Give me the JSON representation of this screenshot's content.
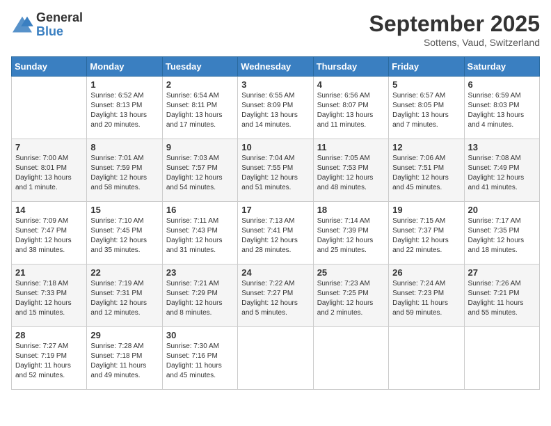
{
  "header": {
    "logo": {
      "general": "General",
      "blue": "Blue"
    },
    "title": "September 2025",
    "location": "Sottens, Vaud, Switzerland"
  },
  "weekdays": [
    "Sunday",
    "Monday",
    "Tuesday",
    "Wednesday",
    "Thursday",
    "Friday",
    "Saturday"
  ],
  "weeks": [
    [
      {
        "day": "",
        "sunrise": "",
        "sunset": "",
        "daylight": ""
      },
      {
        "day": "1",
        "sunrise": "Sunrise: 6:52 AM",
        "sunset": "Sunset: 8:13 PM",
        "daylight": "Daylight: 13 hours and 20 minutes."
      },
      {
        "day": "2",
        "sunrise": "Sunrise: 6:54 AM",
        "sunset": "Sunset: 8:11 PM",
        "daylight": "Daylight: 13 hours and 17 minutes."
      },
      {
        "day": "3",
        "sunrise": "Sunrise: 6:55 AM",
        "sunset": "Sunset: 8:09 PM",
        "daylight": "Daylight: 13 hours and 14 minutes."
      },
      {
        "day": "4",
        "sunrise": "Sunrise: 6:56 AM",
        "sunset": "Sunset: 8:07 PM",
        "daylight": "Daylight: 13 hours and 11 minutes."
      },
      {
        "day": "5",
        "sunrise": "Sunrise: 6:57 AM",
        "sunset": "Sunset: 8:05 PM",
        "daylight": "Daylight: 13 hours and 7 minutes."
      },
      {
        "day": "6",
        "sunrise": "Sunrise: 6:59 AM",
        "sunset": "Sunset: 8:03 PM",
        "daylight": "Daylight: 13 hours and 4 minutes."
      }
    ],
    [
      {
        "day": "7",
        "sunrise": "Sunrise: 7:00 AM",
        "sunset": "Sunset: 8:01 PM",
        "daylight": "Daylight: 13 hours and 1 minute."
      },
      {
        "day": "8",
        "sunrise": "Sunrise: 7:01 AM",
        "sunset": "Sunset: 7:59 PM",
        "daylight": "Daylight: 12 hours and 58 minutes."
      },
      {
        "day": "9",
        "sunrise": "Sunrise: 7:03 AM",
        "sunset": "Sunset: 7:57 PM",
        "daylight": "Daylight: 12 hours and 54 minutes."
      },
      {
        "day": "10",
        "sunrise": "Sunrise: 7:04 AM",
        "sunset": "Sunset: 7:55 PM",
        "daylight": "Daylight: 12 hours and 51 minutes."
      },
      {
        "day": "11",
        "sunrise": "Sunrise: 7:05 AM",
        "sunset": "Sunset: 7:53 PM",
        "daylight": "Daylight: 12 hours and 48 minutes."
      },
      {
        "day": "12",
        "sunrise": "Sunrise: 7:06 AM",
        "sunset": "Sunset: 7:51 PM",
        "daylight": "Daylight: 12 hours and 45 minutes."
      },
      {
        "day": "13",
        "sunrise": "Sunrise: 7:08 AM",
        "sunset": "Sunset: 7:49 PM",
        "daylight": "Daylight: 12 hours and 41 minutes."
      }
    ],
    [
      {
        "day": "14",
        "sunrise": "Sunrise: 7:09 AM",
        "sunset": "Sunset: 7:47 PM",
        "daylight": "Daylight: 12 hours and 38 minutes."
      },
      {
        "day": "15",
        "sunrise": "Sunrise: 7:10 AM",
        "sunset": "Sunset: 7:45 PM",
        "daylight": "Daylight: 12 hours and 35 minutes."
      },
      {
        "day": "16",
        "sunrise": "Sunrise: 7:11 AM",
        "sunset": "Sunset: 7:43 PM",
        "daylight": "Daylight: 12 hours and 31 minutes."
      },
      {
        "day": "17",
        "sunrise": "Sunrise: 7:13 AM",
        "sunset": "Sunset: 7:41 PM",
        "daylight": "Daylight: 12 hours and 28 minutes."
      },
      {
        "day": "18",
        "sunrise": "Sunrise: 7:14 AM",
        "sunset": "Sunset: 7:39 PM",
        "daylight": "Daylight: 12 hours and 25 minutes."
      },
      {
        "day": "19",
        "sunrise": "Sunrise: 7:15 AM",
        "sunset": "Sunset: 7:37 PM",
        "daylight": "Daylight: 12 hours and 22 minutes."
      },
      {
        "day": "20",
        "sunrise": "Sunrise: 7:17 AM",
        "sunset": "Sunset: 7:35 PM",
        "daylight": "Daylight: 12 hours and 18 minutes."
      }
    ],
    [
      {
        "day": "21",
        "sunrise": "Sunrise: 7:18 AM",
        "sunset": "Sunset: 7:33 PM",
        "daylight": "Daylight: 12 hours and 15 minutes."
      },
      {
        "day": "22",
        "sunrise": "Sunrise: 7:19 AM",
        "sunset": "Sunset: 7:31 PM",
        "daylight": "Daylight: 12 hours and 12 minutes."
      },
      {
        "day": "23",
        "sunrise": "Sunrise: 7:21 AM",
        "sunset": "Sunset: 7:29 PM",
        "daylight": "Daylight: 12 hours and 8 minutes."
      },
      {
        "day": "24",
        "sunrise": "Sunrise: 7:22 AM",
        "sunset": "Sunset: 7:27 PM",
        "daylight": "Daylight: 12 hours and 5 minutes."
      },
      {
        "day": "25",
        "sunrise": "Sunrise: 7:23 AM",
        "sunset": "Sunset: 7:25 PM",
        "daylight": "Daylight: 12 hours and 2 minutes."
      },
      {
        "day": "26",
        "sunrise": "Sunrise: 7:24 AM",
        "sunset": "Sunset: 7:23 PM",
        "daylight": "Daylight: 11 hours and 59 minutes."
      },
      {
        "day": "27",
        "sunrise": "Sunrise: 7:26 AM",
        "sunset": "Sunset: 7:21 PM",
        "daylight": "Daylight: 11 hours and 55 minutes."
      }
    ],
    [
      {
        "day": "28",
        "sunrise": "Sunrise: 7:27 AM",
        "sunset": "Sunset: 7:19 PM",
        "daylight": "Daylight: 11 hours and 52 minutes."
      },
      {
        "day": "29",
        "sunrise": "Sunrise: 7:28 AM",
        "sunset": "Sunset: 7:18 PM",
        "daylight": "Daylight: 11 hours and 49 minutes."
      },
      {
        "day": "30",
        "sunrise": "Sunrise: 7:30 AM",
        "sunset": "Sunset: 7:16 PM",
        "daylight": "Daylight: 11 hours and 45 minutes."
      },
      {
        "day": "",
        "sunrise": "",
        "sunset": "",
        "daylight": ""
      },
      {
        "day": "",
        "sunrise": "",
        "sunset": "",
        "daylight": ""
      },
      {
        "day": "",
        "sunrise": "",
        "sunset": "",
        "daylight": ""
      },
      {
        "day": "",
        "sunrise": "",
        "sunset": "",
        "daylight": ""
      }
    ]
  ]
}
